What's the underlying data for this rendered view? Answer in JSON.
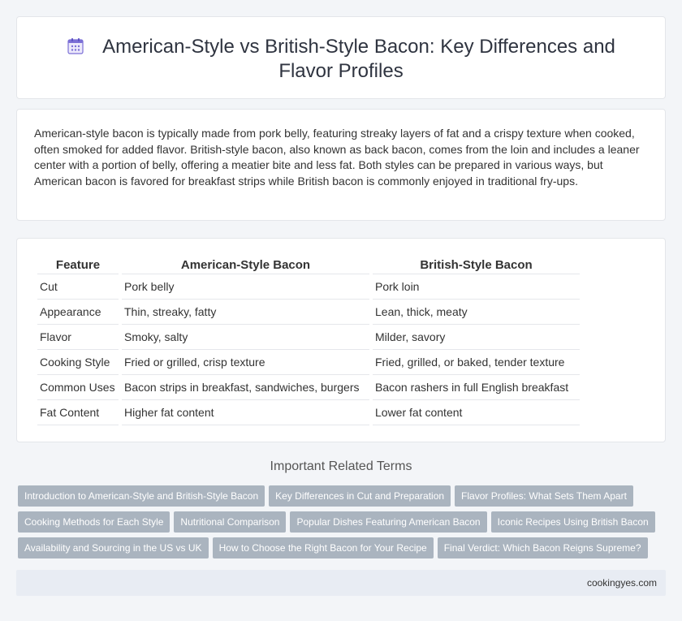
{
  "header": {
    "icon": "calendar-icon",
    "title": "American-Style vs British-Style Bacon: Key Differences and Flavor Profiles"
  },
  "intro": {
    "text": "American-style bacon is typically made from pork belly, featuring streaky layers of fat and a crispy texture when cooked, often smoked for added flavor. British-style bacon, also known as back bacon, comes from the loin and includes a leaner center with a portion of belly, offering a meatier bite and less fat. Both styles can be prepared in various ways, but American bacon is favored for breakfast strips while British bacon is commonly enjoyed in traditional fry-ups."
  },
  "table": {
    "headers": [
      "Feature",
      "American-Style Bacon",
      "British-Style Bacon"
    ],
    "rows": [
      [
        "Cut",
        "Pork belly",
        "Pork loin"
      ],
      [
        "Appearance",
        "Thin, streaky, fatty",
        "Lean, thick, meaty"
      ],
      [
        "Flavor",
        "Smoky, salty",
        "Milder, savory"
      ],
      [
        "Cooking Style",
        "Fried or grilled, crisp texture",
        "Fried, grilled, or baked, tender texture"
      ],
      [
        "Common Uses",
        "Bacon strips in breakfast, sandwiches, burgers",
        "Bacon rashers in full English breakfast"
      ],
      [
        "Fat Content",
        "Higher fat content",
        "Lower fat content"
      ]
    ]
  },
  "related": {
    "title": "Important Related Terms",
    "rows": [
      [
        "Introduction to American-Style and British-Style Bacon",
        "Key Differences in Cut and Preparation",
        "Flavor Profiles: What Sets Them Apart"
      ],
      [
        "Cooking Methods for Each Style",
        "Nutritional Comparison",
        "Popular Dishes Featuring American Bacon",
        "Iconic Recipes Using British Bacon"
      ],
      [
        "Availability and Sourcing in the US vs UK",
        "How to Choose the Right Bacon for Your Recipe",
        "Final Verdict: Which Bacon Reigns Supreme?"
      ]
    ]
  },
  "footer": {
    "site": "cookingyes.com"
  },
  "colors": {
    "tag_background": "#aab4bf",
    "footer_background": "#e8ecf3",
    "icon_accent": "#7b6fd6"
  }
}
